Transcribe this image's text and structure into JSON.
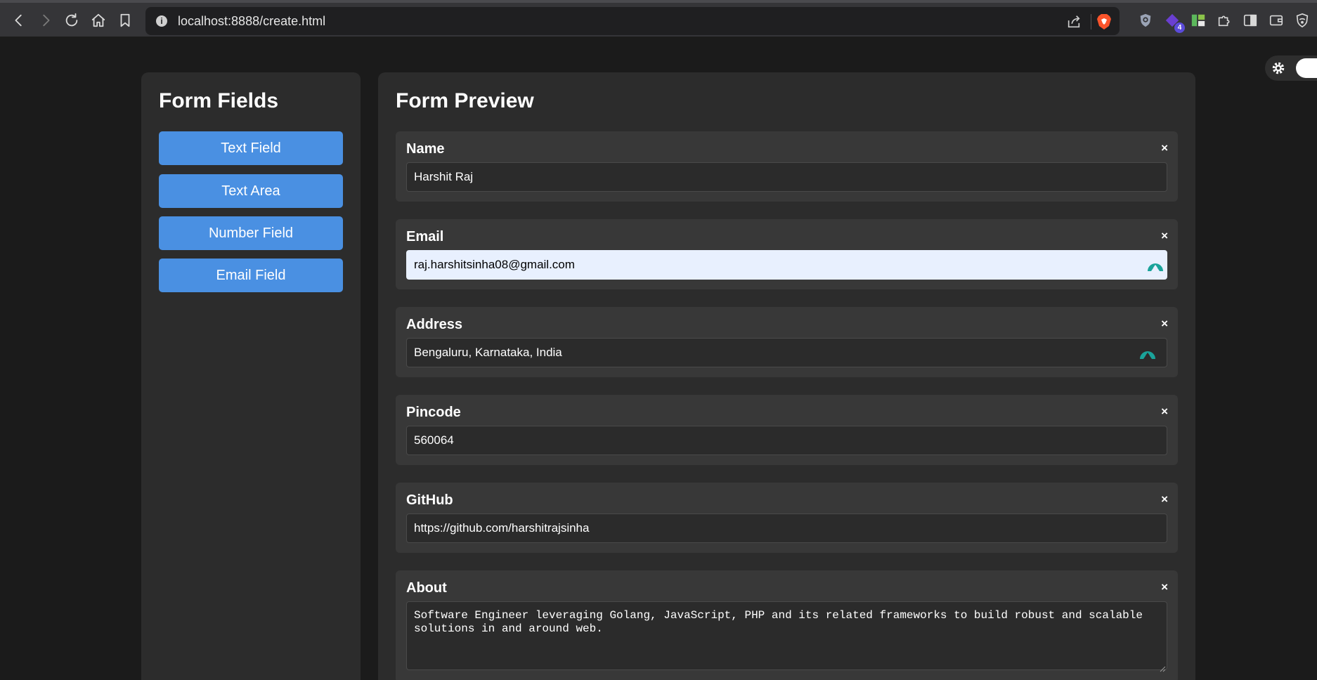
{
  "browser": {
    "url": "localhost:8888/create.html",
    "extension_badge": "4"
  },
  "left_panel": {
    "title": "Form Fields",
    "buttons": [
      "Text Field",
      "Text Area",
      "Number Field",
      "Email Field"
    ]
  },
  "preview": {
    "title": "Form Preview",
    "remove_label": "×",
    "fields": [
      {
        "label": "Name",
        "value": "Harshit Raj"
      },
      {
        "label": "Email",
        "value": "raj.harshitsinha08@gmail.com"
      },
      {
        "label": "Address",
        "value": "Bengaluru, Karnataka, India"
      },
      {
        "label": "Pincode",
        "value": "560064"
      },
      {
        "label": "GitHub",
        "value": "https://github.com/harshitrajsinha"
      },
      {
        "label": "About",
        "value": "Software Engineer leveraging Golang, JavaScript, PHP and its related frameworks to build robust and scalable solutions in and around web."
      }
    ]
  },
  "colors": {
    "accent": "#4a90e2",
    "background": "#1b1b1b",
    "panel": "#2c2c2c",
    "card": "#383838",
    "autofill": "#e8f0fe"
  }
}
